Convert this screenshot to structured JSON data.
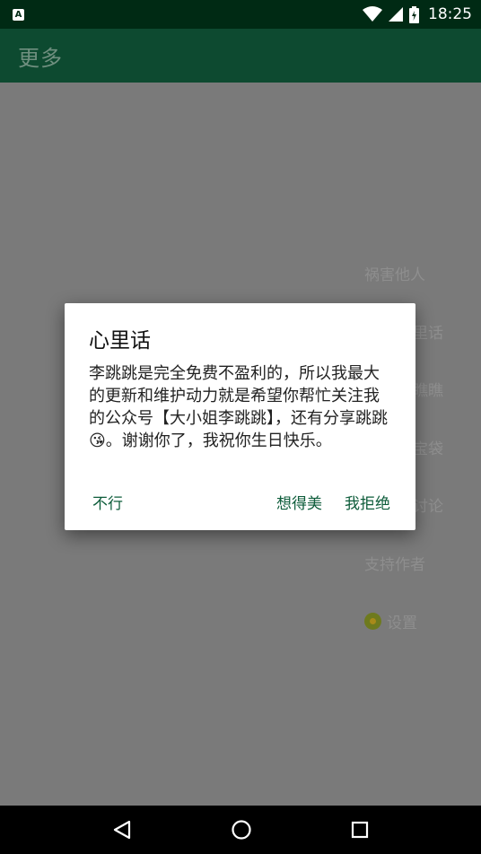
{
  "status_bar": {
    "notification_icon": "A",
    "time": "18:25",
    "icons": [
      "wifi-icon",
      "signal-icon",
      "battery-charging-icon"
    ]
  },
  "app_bar": {
    "title": "更多"
  },
  "menu": {
    "items": [
      {
        "label": "祸害他人"
      },
      {
        "label": "里话"
      },
      {
        "label": "瞧瞧"
      },
      {
        "label": "宝袋"
      },
      {
        "label": "讨论"
      },
      {
        "label": "支持作者"
      },
      {
        "label": "设置",
        "icon": "kiwi-icon"
      }
    ]
  },
  "dialog": {
    "title": "心里话",
    "message": "李跳跳是完全免费不盈利的，所以我最大的更新和维护动力就是希望你帮忙关注我的公众号【大小姐李跳跳】，还有分享跳跳😘。谢谢你了，我祝你生日快乐。",
    "neutral_button": "不行",
    "negative_button": "想得美",
    "positive_button": "我拒绝"
  },
  "nav_bar": {
    "icons": [
      "back-icon",
      "home-icon",
      "recents-icon"
    ]
  },
  "colors": {
    "status_bar": "#002a14",
    "app_bar": "#0d4a30",
    "accent": "#0d5c3a",
    "scrim_background": "#7a7a7a"
  }
}
